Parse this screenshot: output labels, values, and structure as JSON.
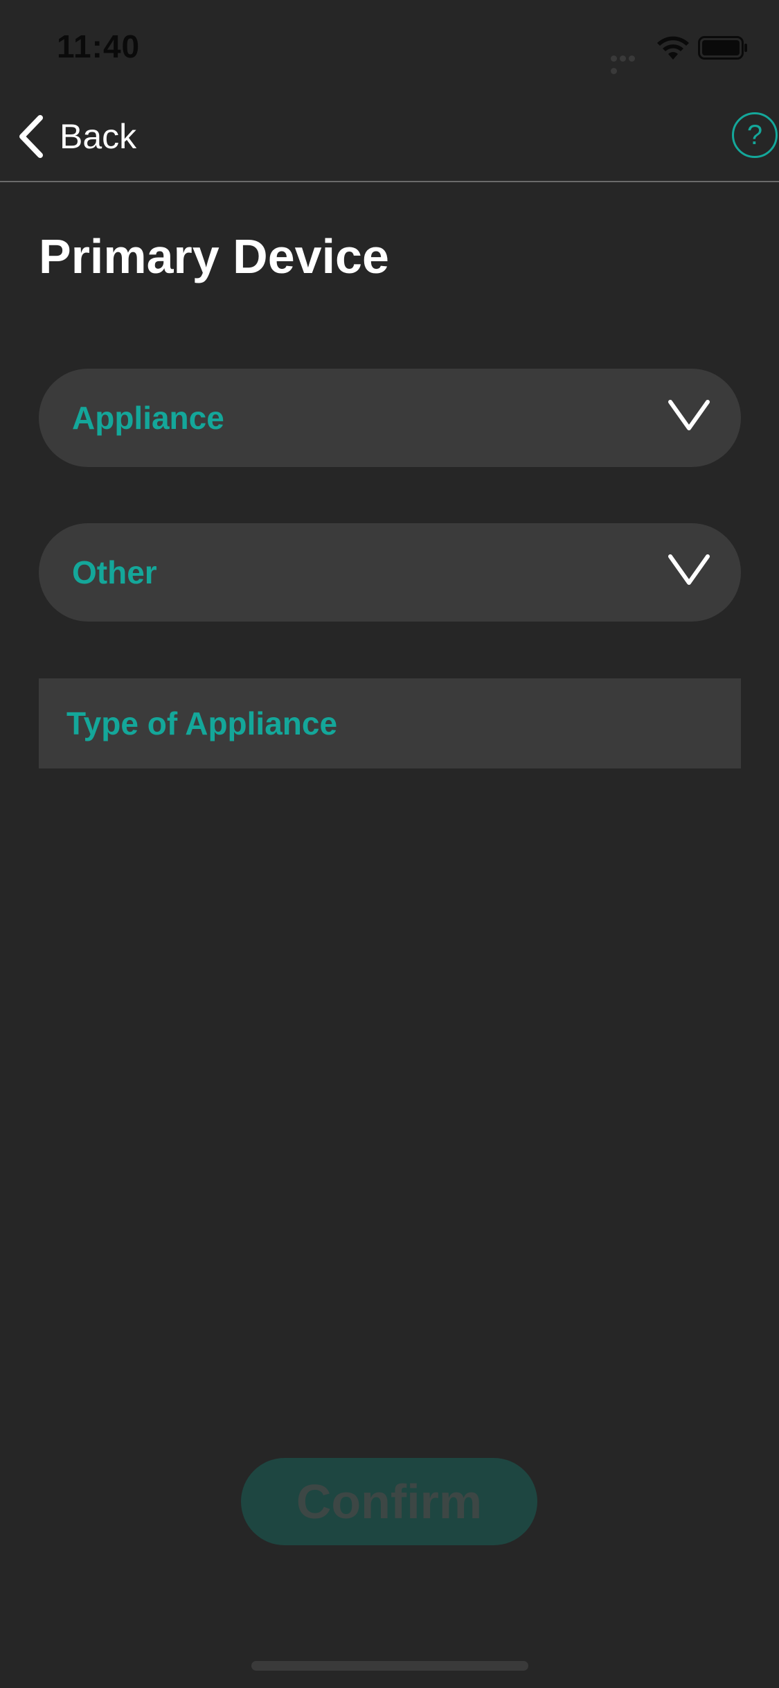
{
  "status_bar": {
    "time": "11:40",
    "icons": [
      "signal-dots-icon",
      "wifi-icon",
      "battery-icon"
    ]
  },
  "nav": {
    "back_label": "Back",
    "help_label": "?"
  },
  "page": {
    "title": "Primary Device"
  },
  "form": {
    "category_value": "Appliance",
    "subcategory_value": "Other",
    "type_of_appliance_placeholder": "Type of Appliance"
  },
  "actions": {
    "confirm_label": "Confirm"
  },
  "colors": {
    "background": "#262626",
    "field_background": "#3b3b3b",
    "accent": "#14a79a",
    "confirm_disabled_bg": "#1e4641",
    "confirm_disabled_text": "#3d4745"
  }
}
